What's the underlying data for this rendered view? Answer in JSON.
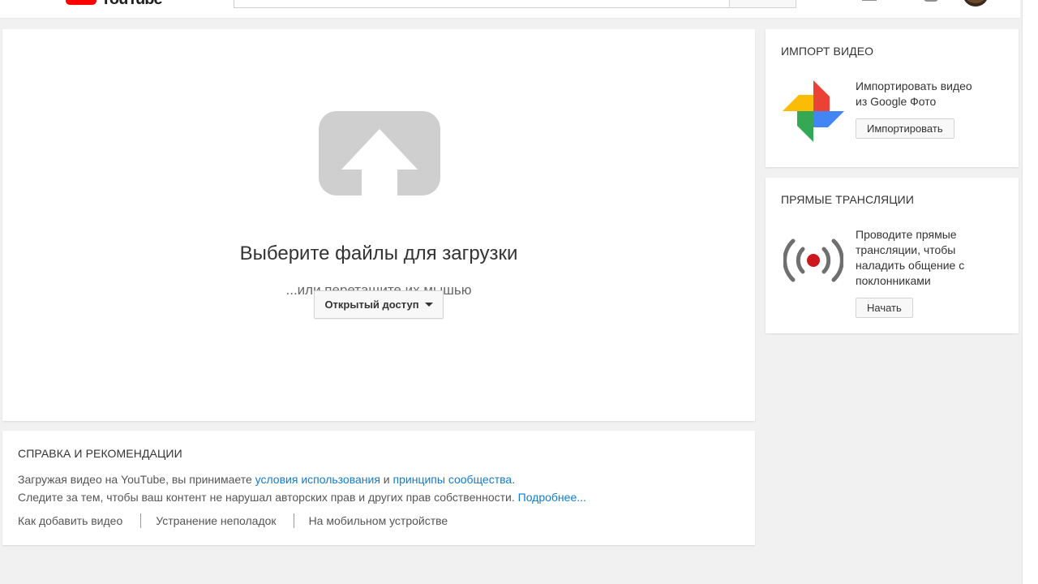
{
  "header": {
    "logo_text": "YouTube"
  },
  "upload": {
    "title": "Выберите файлы для загрузки",
    "subtitle": "...или перетащите их мышью",
    "privacy_label": "Открытый доступ"
  },
  "help": {
    "title": "СПРАВКА И РЕКОМЕНДАЦИИ",
    "line1_prefix": "Загружая видео на YouTube, вы принимаете ",
    "terms_link": "условия использования",
    "line1_and": " и ",
    "guidelines_link": "принципы сообщества",
    "line1_suffix": ".",
    "line2_prefix": "Следите за тем, чтобы ваш контент не нарушал авторских прав и других прав собственности. ",
    "more_link": "Подробнее...",
    "links": [
      "Как добавить видео",
      "Устранение неполадок",
      "На мобильном устройстве"
    ]
  },
  "import_video": {
    "title": "ИМПОРТ ВИДЕО",
    "text_line1": "Импортировать видео",
    "text_line2": "из Google Фото",
    "button_label": "Импортировать",
    "icon": "google-photos-icon"
  },
  "live": {
    "title": "ПРЯМЫЕ ТРАНСЛЯЦИИ",
    "text_lines": [
      "Проводите прямые",
      "трансляции, чтобы",
      "наладить общение с",
      "поклонниками"
    ],
    "button_label": "Начать",
    "icon": "live-broadcast-icon"
  },
  "colors": {
    "link": "#167ac6",
    "brand_red": "#ff0000",
    "background": "#f1f1f1"
  }
}
